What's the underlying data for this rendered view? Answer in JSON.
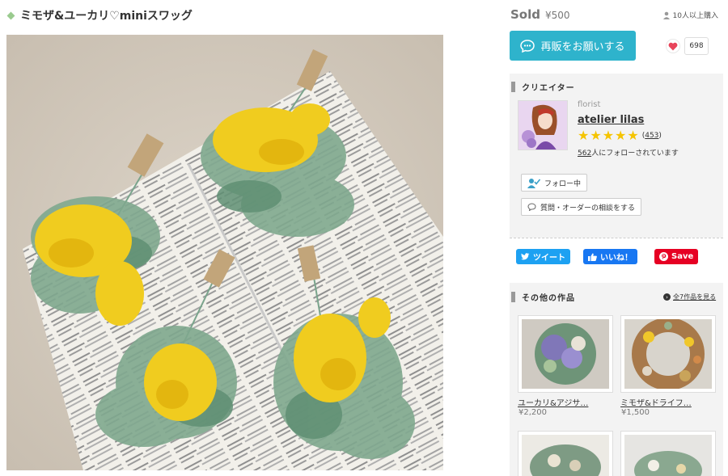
{
  "product": {
    "title": "ミモザ&ユーカリ♡miniスワッグ"
  },
  "purchase": {
    "status": "Sold",
    "price": "¥500",
    "buyers": "10人以上購入",
    "resale_label": "再販をお願いする",
    "like_count": "698"
  },
  "creator": {
    "section_title": "クリエイター",
    "role": "florist",
    "name": "atelier lilas",
    "review_count": "453",
    "follower_count": "562",
    "follower_suffix": "人にフォローされています",
    "follow_label": "フォロー中",
    "inquiry_label": "質問・オーダーの相談をする"
  },
  "share": {
    "tweet": "ツイート",
    "like": "いいね！",
    "save": "Save"
  },
  "other_works": {
    "section_title": "その他の作品",
    "see_all": "全7作品を見る",
    "items": [
      {
        "name": "ユーカリ&アジサ…",
        "price": "¥2,200"
      },
      {
        "name": "ミモザ&ドライフ…",
        "price": "¥1,500"
      }
    ]
  },
  "colors": {
    "accent": "#2eb3cc",
    "star": "#f5c400",
    "twitter": "#1da1f2",
    "facebook": "#1877f2",
    "pinterest": "#e60023"
  }
}
